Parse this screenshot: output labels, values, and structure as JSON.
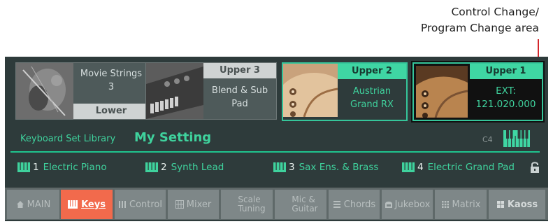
{
  "callout": {
    "line1": "Control Change/",
    "line2": "Program Change area"
  },
  "tiles": [
    {
      "title": "",
      "body_line1": "Movie Strings",
      "body_line2": "3",
      "footer": "Lower",
      "state": "inactive"
    },
    {
      "title": "Upper 3",
      "body_line1": "Blend & Sub",
      "body_line2": "Pad",
      "state": "inactive"
    },
    {
      "title": "Upper 2",
      "body_line1": "Austrian",
      "body_line2": "Grand RX",
      "state": "active"
    },
    {
      "title": "Upper 1",
      "body_line1": "EXT:",
      "body_line2": "121.020.000",
      "state": "active-selected"
    }
  ],
  "library": {
    "label": "Keyboard Set Library",
    "name": "My Setting",
    "split_point": "C4"
  },
  "keyboard_sets": [
    {
      "num": "1",
      "name": "Electric Piano"
    },
    {
      "num": "2",
      "name": "Synth Lead"
    },
    {
      "num": "3",
      "name": "Sax Ens. & Brass"
    },
    {
      "num": "4",
      "name": "Electric Grand Pad"
    }
  ],
  "tabs": {
    "main": "MAIN",
    "keys": "Keys",
    "control": "Control",
    "mixer": "Mixer",
    "scale_1": "Scale",
    "scale_2": "Tuning",
    "mic_1": "Mic &",
    "mic_2": "Guitar",
    "chords": "Chords",
    "jukebox": "Jukebox",
    "matrix": "Matrix",
    "kaoss": "Kaoss",
    "active": "Keys"
  },
  "colors": {
    "accent_green": "#35c59a",
    "tab_active": "#f26a4c",
    "callout_line": "#d4262b"
  }
}
